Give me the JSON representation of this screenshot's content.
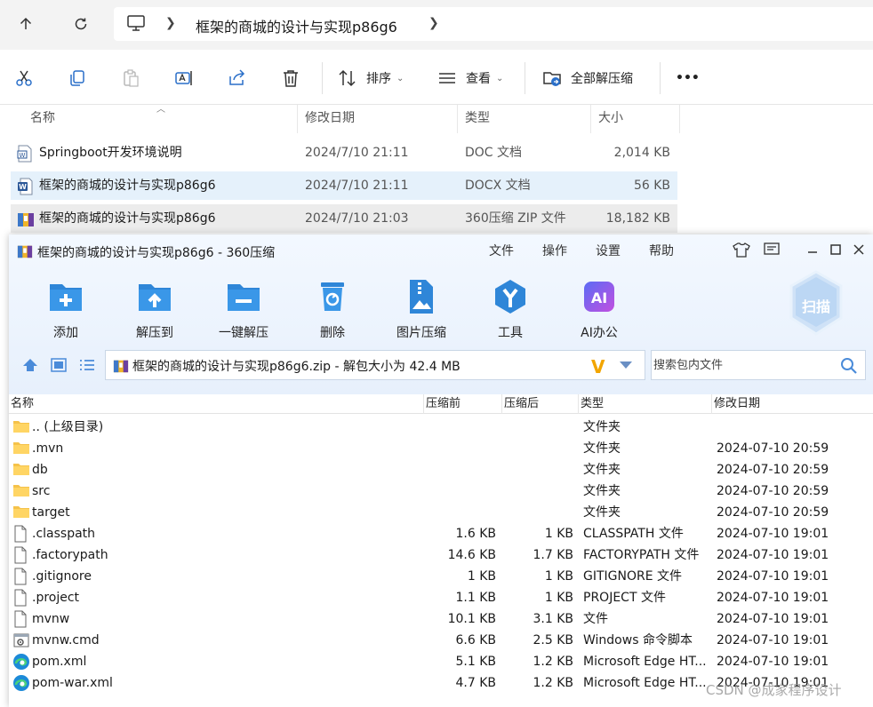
{
  "explorer": {
    "breadcrumb": "框架的商城的设计与实现p86g6",
    "toolbar": {
      "sort_label": "排序",
      "view_label": "查看",
      "extract_all_label": "全部解压缩",
      "more_label": "•••"
    },
    "columns": {
      "name": "名称",
      "date": "修改日期",
      "type": "类型",
      "size": "大小"
    },
    "files": [
      {
        "name": "Springboot开发环境说明",
        "date": "2024/7/10 21:11",
        "type": "DOC 文档",
        "size": "2,014 KB",
        "icon": "word-doc-icon"
      },
      {
        "name": "框架的商城的设计与实现p86g6",
        "date": "2024/7/10 21:11",
        "type": "DOCX 文档",
        "size": "56 KB",
        "icon": "word-docx-icon"
      },
      {
        "name": "框架的商城的设计与实现p86g6",
        "date": "2024/7/10 21:03",
        "type": "360压缩 ZIP 文件",
        "size": "18,182 KB",
        "icon": "zip-archive-icon"
      }
    ]
  },
  "zip": {
    "title": "框架的商城的设计与实现p86g6 - 360压缩",
    "menu": [
      "文件",
      "操作",
      "设置",
      "帮助"
    ],
    "tools": [
      {
        "label": "添加",
        "icon": "add-icon"
      },
      {
        "label": "解压到",
        "icon": "extract-to-icon"
      },
      {
        "label": "一键解压",
        "icon": "one-click-extract-icon"
      },
      {
        "label": "删除",
        "icon": "delete-icon"
      },
      {
        "label": "图片压缩",
        "icon": "image-compress-icon"
      },
      {
        "label": "工具",
        "icon": "tools-icon"
      },
      {
        "label": "AI办公",
        "icon": "ai-office-icon"
      }
    ],
    "scan_label": "扫描",
    "path_text": "框架的商城的设计与实现p86g6.zip - 解包大小为 42.4 MB",
    "search_placeholder": "搜索包内文件",
    "columns": {
      "name": "名称",
      "original": "压缩前",
      "compressed": "压缩后",
      "type": "类型",
      "date": "修改日期"
    },
    "rows": [
      {
        "name": ".. (上级目录)",
        "orig": "",
        "comp": "",
        "type": "文件夹",
        "date": "",
        "icon": "folder-icon"
      },
      {
        "name": ".mvn",
        "orig": "",
        "comp": "",
        "type": "文件夹",
        "date": "2024-07-10 20:59",
        "icon": "folder-icon"
      },
      {
        "name": "db",
        "orig": "",
        "comp": "",
        "type": "文件夹",
        "date": "2024-07-10 20:59",
        "icon": "folder-icon"
      },
      {
        "name": "src",
        "orig": "",
        "comp": "",
        "type": "文件夹",
        "date": "2024-07-10 20:59",
        "icon": "folder-icon"
      },
      {
        "name": "target",
        "orig": "",
        "comp": "",
        "type": "文件夹",
        "date": "2024-07-10 20:59",
        "icon": "folder-icon"
      },
      {
        "name": ".classpath",
        "orig": "1.6 KB",
        "comp": "1 KB",
        "type": "CLASSPATH 文件",
        "date": "2024-07-10 19:01",
        "icon": "file-icon"
      },
      {
        "name": ".factorypath",
        "orig": "14.6 KB",
        "comp": "1.7 KB",
        "type": "FACTORYPATH 文件",
        "date": "2024-07-10 19:01",
        "icon": "file-icon"
      },
      {
        "name": ".gitignore",
        "orig": "1 KB",
        "comp": "1 KB",
        "type": "GITIGNORE 文件",
        "date": "2024-07-10 19:01",
        "icon": "file-icon"
      },
      {
        "name": ".project",
        "orig": "1.1 KB",
        "comp": "1 KB",
        "type": "PROJECT 文件",
        "date": "2024-07-10 19:01",
        "icon": "file-icon"
      },
      {
        "name": "mvnw",
        "orig": "10.1 KB",
        "comp": "3.1 KB",
        "type": "文件",
        "date": "2024-07-10 19:01",
        "icon": "file-icon"
      },
      {
        "name": "mvnw.cmd",
        "orig": "6.6 KB",
        "comp": "2.5 KB",
        "type": "Windows 命令脚本",
        "date": "2024-07-10 19:01",
        "icon": "cmd-script-icon"
      },
      {
        "name": "pom.xml",
        "orig": "5.1 KB",
        "comp": "1.2 KB",
        "type": "Microsoft Edge HT...",
        "date": "2024-07-10 19:01",
        "icon": "edge-icon"
      },
      {
        "name": "pom-war.xml",
        "orig": "4.7 KB",
        "comp": "1.2 KB",
        "type": "Microsoft Edge HT...",
        "date": "2024-07-10 19:01",
        "icon": "edge-icon"
      }
    ]
  },
  "watermark": "CSDN @成家程序设计"
}
